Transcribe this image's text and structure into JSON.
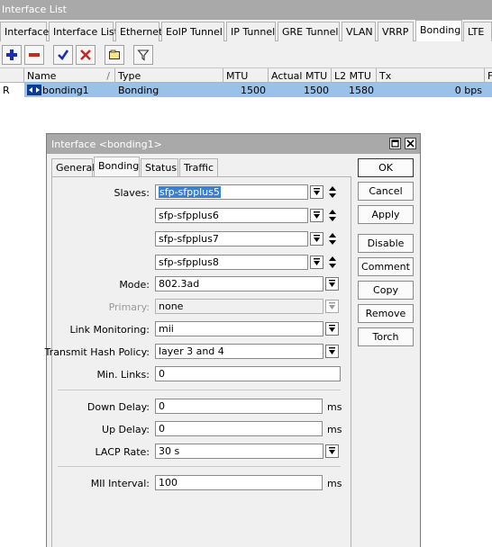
{
  "app": {
    "title": "Interface List"
  },
  "tabs": [
    "Interface",
    "Interface List",
    "Ethernet",
    "EoIP Tunnel",
    "IP Tunnel",
    "GRE Tunnel",
    "VLAN",
    "VRRP",
    "Bonding",
    "LTE"
  ],
  "active_tab": "Bonding",
  "toolbar": {
    "buttons": [
      "add-icon",
      "remove-icon",
      "enable-check-icon",
      "disable-x-icon",
      "comment-icon",
      "filter-icon"
    ],
    "colors": {
      "add": "#1a2eb5",
      "remove": "#c62828",
      "check": "#1a2eb5",
      "x": "#c62828"
    }
  },
  "table": {
    "columns": [
      "",
      "Name",
      "Type",
      "MTU",
      "Actual MTU",
      "L2 MTU",
      "Tx",
      "F"
    ],
    "sort_marker": "/",
    "rows": [
      {
        "flag": "R",
        "name": "bonding1",
        "type": "Bonding",
        "mtu": "1500",
        "actual_mtu": "1500",
        "l2_mtu": "1580",
        "tx": "0 bps"
      }
    ]
  },
  "dialog": {
    "title": "Interface <bonding1>",
    "tabs": [
      "General",
      "Bonding",
      "Status",
      "Traffic"
    ],
    "active_tab": "Bonding",
    "labels": {
      "slaves": "Slaves:",
      "mode": "Mode:",
      "primary": "Primary:",
      "link_monitoring": "Link Monitoring:",
      "transmit_hash_policy": "Transmit Hash Policy:",
      "min_links": "Min. Links:",
      "down_delay": "Down Delay:",
      "up_delay": "Up Delay:",
      "lacp_rate": "LACP Rate:",
      "mii_interval": "MII Interval:"
    },
    "values": {
      "slaves": [
        "sfp-sfpplus5",
        "sfp-sfpplus6",
        "sfp-sfpplus7",
        "sfp-sfpplus8"
      ],
      "mode": "802.3ad",
      "primary": "none",
      "link_monitoring": "mii",
      "transmit_hash_policy": "layer 3 and 4",
      "min_links": "0",
      "down_delay": "0",
      "up_delay": "0",
      "lacp_rate": "30 s",
      "mii_interval": "100"
    },
    "units": {
      "down_delay": "ms",
      "up_delay": "ms",
      "mii_interval": "ms"
    },
    "buttons": [
      "OK",
      "Cancel",
      "Apply",
      "Disable",
      "Comment",
      "Copy",
      "Remove",
      "Torch"
    ]
  }
}
